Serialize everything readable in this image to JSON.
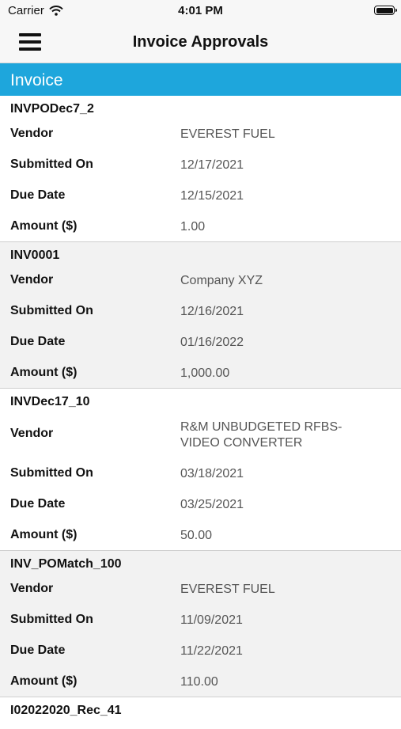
{
  "status_bar": {
    "carrier": "Carrier",
    "time": "4:01 PM"
  },
  "nav": {
    "title": "Invoice Approvals",
    "menu_icon": "hamburger-menu-icon"
  },
  "section": {
    "title": "Invoice"
  },
  "field_labels": {
    "vendor": "Vendor",
    "submitted_on": "Submitted On",
    "due_date": "Due Date",
    "amount": "Amount ($)"
  },
  "invoices": [
    {
      "id": "INVPODec7_2",
      "vendor": "EVEREST FUEL",
      "submitted_on": "12/17/2021",
      "due_date": "12/15/2021",
      "amount": "1.00"
    },
    {
      "id": "INV0001",
      "vendor": "Company XYZ",
      "submitted_on": "12/16/2021",
      "due_date": "01/16/2022",
      "amount": "1,000.00"
    },
    {
      "id": "INVDec17_10",
      "vendor": "R&M UNBUDGETED RFBS-VIDEO CONVERTER",
      "submitted_on": "03/18/2021",
      "due_date": "03/25/2021",
      "amount": "50.00"
    },
    {
      "id": "INV_POMatch_100",
      "vendor": "EVEREST FUEL",
      "submitted_on": "11/09/2021",
      "due_date": "11/22/2021",
      "amount": "110.00"
    },
    {
      "id": "I02022020_Rec_41"
    }
  ]
}
